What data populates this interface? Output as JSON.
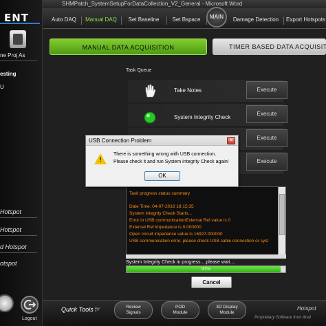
{
  "window": {
    "title": "SHMPatch_SystemSetupForDataCollection_V2_General - Microsoft Word"
  },
  "sidebar": {
    "logo": "ENT",
    "proj_label": "ne Proj As",
    "items": [
      "esting",
      "U"
    ],
    "hotspots": [
      "Hotspot",
      "Hotspot",
      "d Hotspot",
      "otspot"
    ],
    "logout_label": "Logout"
  },
  "tabs": {
    "items": [
      "Auto DAQ",
      "Manual DAQ",
      "Set Baseline",
      "Set Bspace",
      "Damage Detection",
      "Export Hotspots"
    ],
    "active": "Manual DAQ",
    "main_label": "MAIN"
  },
  "modes": {
    "manual": "Manual Data Acquisition",
    "timer": "Timer Based Data Acquisition"
  },
  "task_queue": {
    "label": "Task Queue",
    "tasks": [
      {
        "label": "Take Notes",
        "icon": "hand-icon",
        "button": "Execute"
      },
      {
        "label": "System Integrity Check",
        "icon": "green-status-icon",
        "button": "Execute"
      },
      {
        "label": "",
        "icon": "",
        "button": "Execute"
      },
      {
        "label": "",
        "icon": "",
        "button": "Execute"
      }
    ]
  },
  "log": {
    "lines": [
      "Task progress status summary",
      "",
      "Date Time: 04-07-2016 18:15:35",
      "System Integrity Check Starts...",
      "Error in USB communicationExternal Ref value is 0",
      "External Ref impedance is 0.000000",
      "Open circuit impedance value is 16927.000000",
      "USB communication error, please check USB cable connection or syst"
    ]
  },
  "progress": {
    "label": "System Integrity Check in progress....please wait....",
    "value": 0.97,
    "text": "97%",
    "cancel_label": "Cancel"
  },
  "quick_tools": {
    "label": "Quick Tools :",
    "buttons": [
      {
        "line1": "Review",
        "line2": "Signals"
      },
      {
        "line1": "POD",
        "line2": "Module"
      },
      {
        "line1": "3D Display",
        "line2": "Module"
      }
    ],
    "brand": "Hotspot",
    "brand_sub": "Proprietary Software from Anal"
  },
  "dialog": {
    "title": "USB Connection Problem",
    "line1": "There is something wrong with USB connection.",
    "line2": "Please check it and run System Integrity Check again!",
    "ok_label": "OK",
    "icon": "warning-icon"
  },
  "colors": {
    "accent_green": "#6cc02a",
    "log_text": "#ff8c1a",
    "warning": "#f2c200"
  }
}
